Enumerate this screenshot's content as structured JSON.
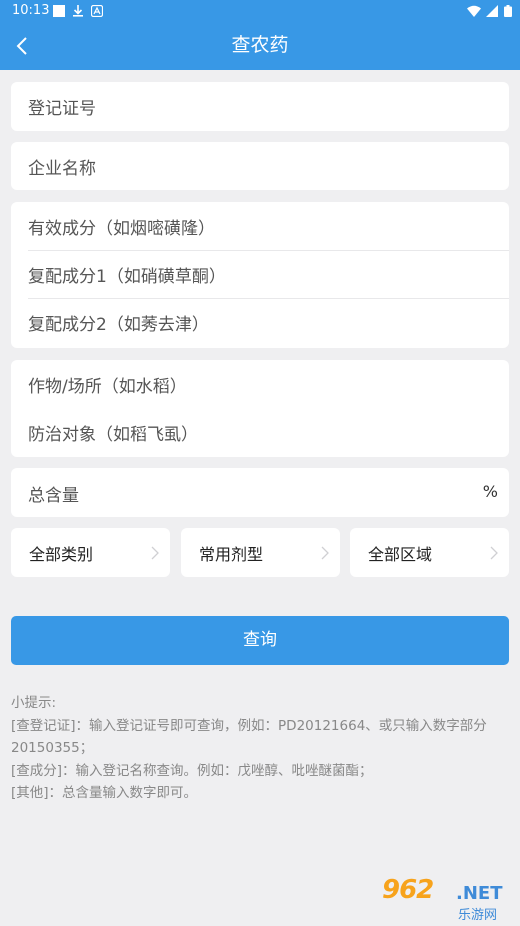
{
  "status_bar": {
    "time": "10:13"
  },
  "app_bar": {
    "title": "查农药"
  },
  "form": {
    "registration_no": "登记证号",
    "company_name": "企业名称",
    "active_ingredient": "有效成分（如烟嘧磺隆）",
    "compound_ingredient_1": "复配成分1（如硝磺草酮）",
    "compound_ingredient_2": "复配成分2（如莠去津）",
    "crop_site": "作物/场所（如水稻）",
    "control_target": "防治对象（如稻飞虱）",
    "total_content": "总含量",
    "total_content_unit": "%"
  },
  "selectors": {
    "category": "全部类别",
    "formulation": "常用剂型",
    "region": "全部区域"
  },
  "query_button": "查询",
  "tips": {
    "title": "小提示:",
    "line1": "[查登记证]：输入登记证号即可查询，例如：PD20121664、或只输入数字部分20150355；",
    "line2": "[查成分]：输入登记名称查询。例如：戊唑醇、吡唑醚菌酯；",
    "line3": "[其他]：总含量输入数字即可。"
  },
  "watermark": {
    "number": "962",
    "net": ".NET",
    "site": "乐游网"
  }
}
